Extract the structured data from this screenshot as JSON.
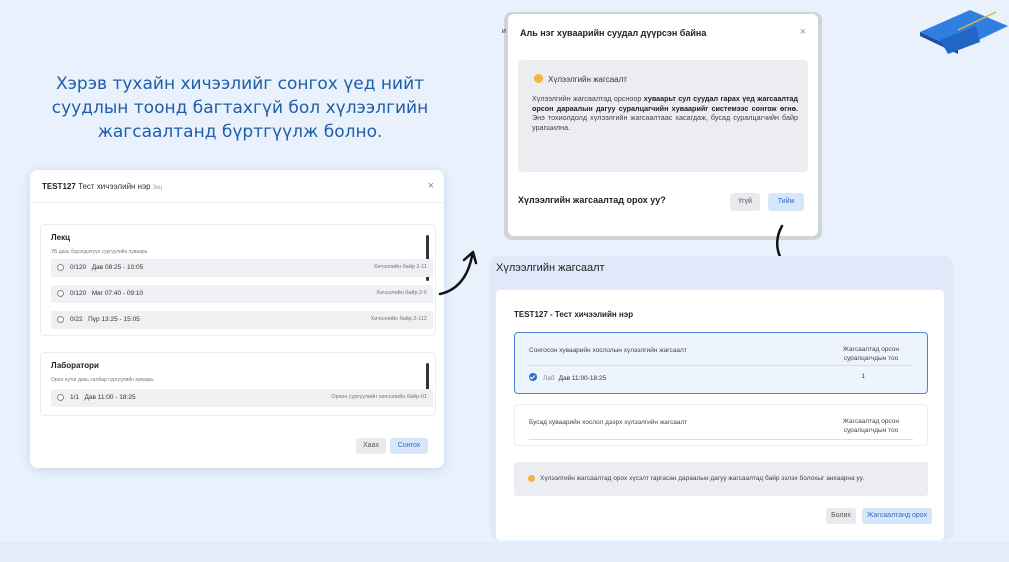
{
  "caption": "Хэрэв тухайн хичээлийг сонгох үед нийт суудлын тоонд багтахгүй бол хүлээлгийн жагсаалтанд бүртгүүлж болно.",
  "dialog_select": {
    "code": "TEST127",
    "name": "Тест хичээлийн нэр",
    "tag": "3кц",
    "close_icon": "×",
    "lecture": {
      "title": "Лекц",
      "subtitle": "УБ дахь бүрэлдэхүүн сургуулийн хуваарь",
      "rows": [
        {
          "seats": "0/120",
          "time": "Дав 08:25 - 10:05",
          "room": "Хичээлийн байр 2-11"
        },
        {
          "seats": "0/120",
          "time": "Мяг 07:40 - 09:10",
          "room": "Хичээлийн байр 2-6"
        },
        {
          "seats": "0/22",
          "time": "Пүр 13:25 - 15:05",
          "room": "Хичээлийн байр 2-112"
        }
      ]
    },
    "lab": {
      "title": "Лаборатори",
      "subtitle": "Орон нутаг дахь салбар сургуулийн хуваарь",
      "rows": [
        {
          "seats": "1/1",
          "time": "Дав 11:00 - 18:25",
          "room": "Орхон сургуулийн хичээлийн байр-01"
        }
      ]
    },
    "close_button": "Хаах",
    "select_button": "Сонгох"
  },
  "dialog_full": {
    "title": "Аль нэг хуваарийн суудал дүүрсэн байна",
    "peek_prefix": "и",
    "close_icon": "×",
    "info_title": "Хүлээлгийн жагсаалт",
    "info_body_1": "Хүлээлгийн жагсаалтад орсноор ",
    "info_body_bold": "хуваарьт сул суудал гарах үед жагсаалтад орсон дараалын дагуу суралцагчийн хуваарийг системээс сонгож өгнө.",
    "info_body_2": " Энэ тохиолдолд хүлээлгийн жагсаалтаас хасагдаж, бусад суралцагчийн байр урагшилна.",
    "question": "Хүлээлгийн жагсаалтад орох уу?",
    "no_button": "Үгүй",
    "yes_button": "Тийм"
  },
  "dialog_waitlist": {
    "panel_title": "Хүлээлгийн жагсаалт",
    "course": "TEST127 - Тест хичээлийн нэр",
    "selected_card": {
      "header": "Сонгосон хуваарийн хослолын хүлээлгийн жагсаалт",
      "count_header_1": "Жагсаалтад орсон",
      "count_header_2": "суралцагчдын тоо",
      "row_type": "Лаб",
      "row_time": "Дав  11:00-18:25",
      "row_count": "1"
    },
    "other_card": {
      "header": "Бусад хуваарийн хослол дээрх хүлээлгийн жагсаалт",
      "count_header_1": "Жагсаалтад орсон",
      "count_header_2": "суралцагчдын тоо"
    },
    "note": "Хүлээлгийн жагсаалтад орох хүсэлт гаргасан дараалын дагуу жагсаалтад байр эзлэх болохыг анхаарна уу.",
    "cancel_button": "Болих",
    "join_button": "Жагсаалтанд орох"
  }
}
